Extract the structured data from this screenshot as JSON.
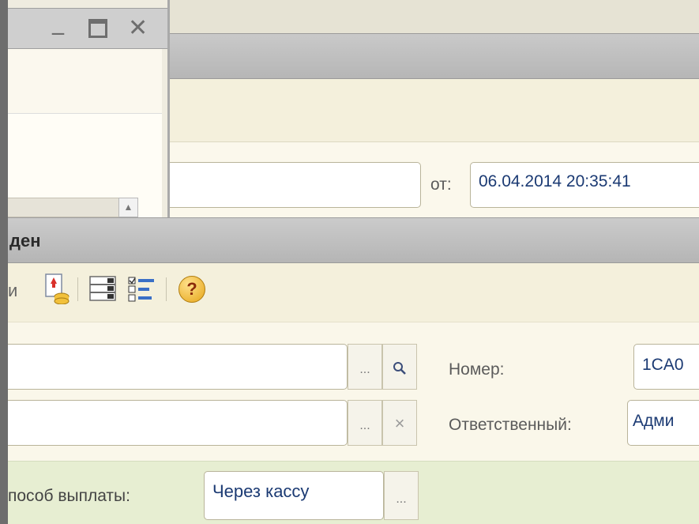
{
  "bg_window": {
    "date_label": "от:",
    "date_value": "06.04.2014 20:35:41"
  },
  "left_window": {
    "minimize_glyph": "_",
    "maximize_glyph": "☐",
    "close_glyph": "✕",
    "column_header_partial": "",
    "scroll_up_glyph": "▲"
  },
  "front_window": {
    "title_partial": "ден",
    "toolbar_partial_text": "и",
    "toolbar_icons": [
      "load-from-db-icon",
      "list-settings-icon",
      "checklist-icon",
      "help-icon"
    ],
    "help_glyph": "?",
    "fields": {
      "field1_select_glyph": "...",
      "field1_search_glyph": "⚲",
      "number_label": "Номер:",
      "number_value": "1CA0",
      "field2_select_glyph": "...",
      "field2_clear_glyph": "×",
      "responsible_label": "Ответственный:",
      "responsible_value": "Адми"
    },
    "payment": {
      "label": "пособ выплаты:",
      "value": "Через кассу",
      "select_glyph": "..."
    }
  },
  "colors": {
    "text_value": "#1b3a73",
    "label": "#5b5b5b",
    "title_bar": "#c0c0c0",
    "green_panel": "#e7eed2"
  }
}
